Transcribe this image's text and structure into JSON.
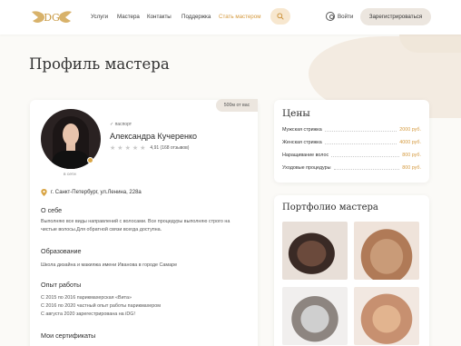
{
  "header": {
    "nav": [
      {
        "label": "Услуги"
      },
      {
        "label": "Мастера"
      },
      {
        "label": "Контакты"
      },
      {
        "label": "Поддержка"
      },
      {
        "label": "Стать мастером"
      }
    ],
    "login_label": "Войти",
    "register_label": "Зарегистрироваться"
  },
  "page_title": "Профиль мастера",
  "profile": {
    "distance": "500м от вас",
    "passport": "паспорт",
    "name": "Александра Кучеренко",
    "rating_value": "4,91",
    "reviews": "(168 отзывов)",
    "stars": 4,
    "status": "в сети",
    "address": "г. Санкт-Петербург, ул.Ленина, 228а"
  },
  "about": {
    "title": "О себе",
    "text": "Выполняю все виды направлений с волосами. Все процедуры выполняю строго на чистые волосы.Для обратной связи всегда доступна."
  },
  "education": {
    "title": "Образование",
    "text": "Школа дизайна и макияжа имени Иванова в городе Самаре"
  },
  "experience": {
    "title": "Опыт работы",
    "lines": [
      "С 2015 по 2016 парикмахерская «Вита»",
      "С 2016 по 2020 частный опыт работы парикмахером",
      "С августа 2020 зарегестрирована на iDG!"
    ]
  },
  "certificates": {
    "title": "Мои сертификаты"
  },
  "prices": {
    "title": "Цены",
    "items": [
      {
        "name": "Мужская стрижка",
        "price": "2000 руб."
      },
      {
        "name": "Женская стрижка",
        "price": "4000 руб."
      },
      {
        "name": "Наращивание волос",
        "price": "800 руб."
      },
      {
        "name": "Уходовые процедуры",
        "price": "800 руб."
      }
    ]
  },
  "portfolio": {
    "title": "Портфолио мастера"
  },
  "colors": {
    "accent": "#d59a3f",
    "button_bg": "#ece6df"
  }
}
